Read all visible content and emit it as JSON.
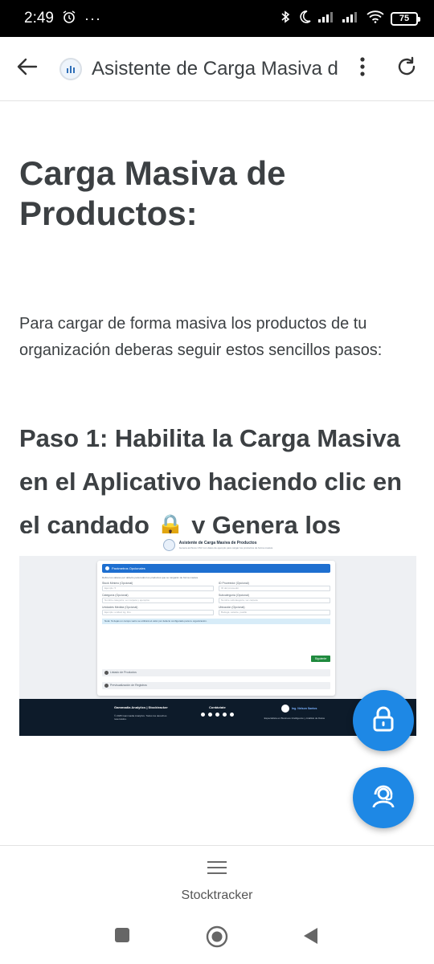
{
  "status_bar": {
    "time": "2:49",
    "more": "···",
    "battery": "75"
  },
  "app_bar": {
    "title": "Asistente de Carga Masiva d"
  },
  "content": {
    "heading": "Carga Masiva de Productos:",
    "intro": "Para cargar de forma masiva los productos de tu organización deberas seguir estos sencillos pasos:",
    "step1_a": "Paso 1: Habilita la Carga Masiva en el Aplicativo haciendo clic en el candado",
    "step1_emoji_lock": "🔒",
    "step1_b": "y Genera los Archivos CSV",
    "step1_emoji_clip": "📋"
  },
  "embedded_screenshot": {
    "title": "Asistente de Carga Masiva de Productos",
    "subtitle": "Genera archivos CSV con datos de ejemplo para cargar tus productos de forma masiva",
    "card_header": "Parámetros Opcionales",
    "card_note": "Define los valores por defecto para todos los productos que se cargarán de forma masiva.",
    "fields": [
      {
        "label": "Stock Mínimo (Opcional)",
        "placeholder": "Ejemplo: 5"
      },
      {
        "label": "ID Proveedor (Opcional)",
        "placeholder": "ID del proveedor"
      },
      {
        "label": "Categoría (Opcional)",
        "placeholder": "Nombre categoría, ver carpeta y ejemplos"
      },
      {
        "label": "Subcategoría (Opcional)",
        "placeholder": "Nombre subcategoría, ver carpeta"
      },
      {
        "label": "Unidades Medida (Opcional)",
        "placeholder": "Ejemplo: unidad, kg, litro"
      },
      {
        "label": "Ubicación (Opcional)",
        "placeholder": "Bodega, estante, pasillo"
      }
    ],
    "alert": "Nota: Si dejas un campo vacío se utilizará el valor por defecto configurado para tu organización.",
    "next_button": "Siguiente",
    "section_1": "Listado de Productos",
    "section_2": "Previsualización de Registros",
    "footer_brand": "Gammadia Analytics | Stocktracker",
    "footer_copy": "© 2025 Gammadia Analytics. Todos los derechos reservados.",
    "footer_contact": "Contáctate",
    "footer_person": "Ing. Nelson Santos",
    "footer_role": "Especialista en Business Intelligence y Análisis de Datos"
  },
  "bottom_nav": {
    "label": "Stocktracker"
  },
  "colors": {
    "fab": "#1e88e5",
    "text": "#3c4043",
    "footer": "#0d1b2a"
  }
}
